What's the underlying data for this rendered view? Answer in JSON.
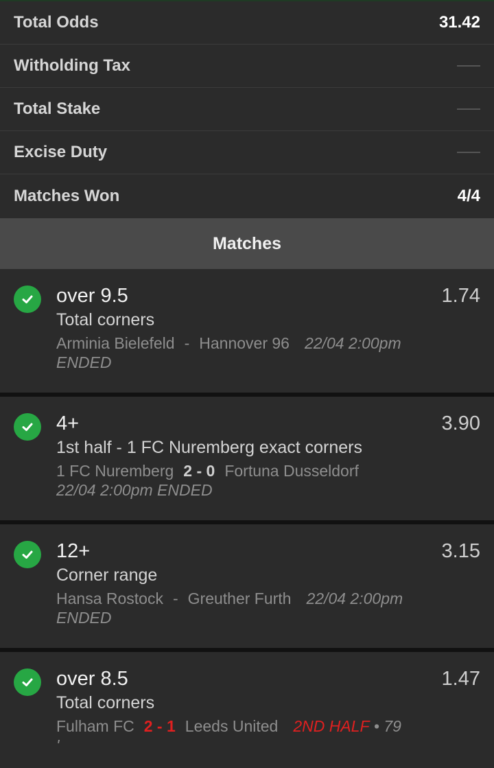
{
  "summary": {
    "total_odds_label": "Total Odds",
    "total_odds_value": "31.42",
    "withholding_tax_label": "Witholding Tax",
    "total_stake_label": "Total Stake",
    "excise_duty_label": "Excise Duty",
    "matches_won_label": "Matches Won",
    "matches_won_value": "4/4"
  },
  "matches_header": "Matches",
  "bets": [
    {
      "pick": "over 9.5",
      "odds": "1.74",
      "market": "Total corners",
      "home": "Arminia Bielefeld",
      "separator": "-",
      "away": "Hannover 96",
      "when": "22/04 2:00pm",
      "status": "ENDED"
    },
    {
      "pick": "4+",
      "odds": "3.90",
      "market": "1st half - 1 FC Nuremberg exact corners",
      "home": "1 FC Nuremberg",
      "score": "2 - 0",
      "away": "Fortuna Dusseldorf",
      "when_status": "22/04 2:00pm ENDED"
    },
    {
      "pick": "12+",
      "odds": "3.15",
      "market": "Corner range",
      "home": "Hansa Rostock",
      "separator": "-",
      "away": "Greuther Furth",
      "when": "22/04 2:00pm",
      "status": "ENDED"
    },
    {
      "pick": "over 8.5",
      "odds": "1.47",
      "market": "Total corners",
      "home": "Fulham FC",
      "score": "2 - 1",
      "away": "Leeds United",
      "live_status": "2ND HALF",
      "minute": "• 79",
      "minute_tail": "'"
    }
  ],
  "colors": {
    "won_check": "#27a744",
    "live_red": "#e02020"
  }
}
